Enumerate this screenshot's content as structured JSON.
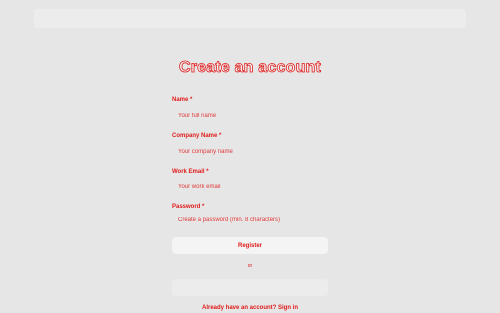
{
  "form": {
    "title": "Create an account",
    "fields": [
      {
        "label": "Name *",
        "placeholder": "Your full name"
      },
      {
        "label": "Company Name *",
        "placeholder": "Your company name"
      },
      {
        "label": "Work Email *",
        "placeholder": "Your work email"
      },
      {
        "label": "Password *",
        "placeholder": "Create a password (min. 8 characters)"
      }
    ],
    "register_label": "Register",
    "divider_text": "or",
    "provider_button_label": ""
  },
  "footer": {
    "prompt": "Already have an account?",
    "signin_link": "Sign in"
  }
}
